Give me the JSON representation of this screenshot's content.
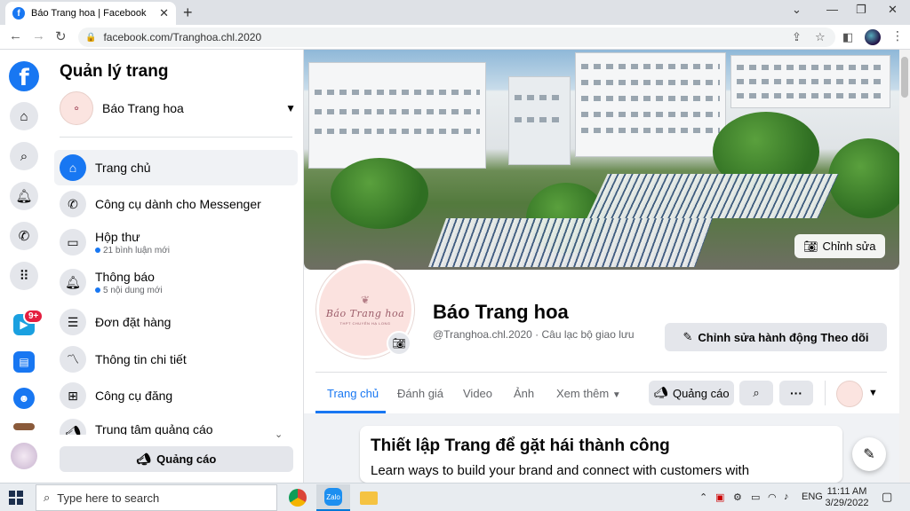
{
  "browser": {
    "tab_title": "Báo Trang hoa | Facebook",
    "url": "facebook.com/Tranghoa.chl.2020"
  },
  "panel": {
    "title": "Quản lý trang",
    "page_name": "Báo Trang hoa",
    "menu": [
      {
        "label": "Trang chủ",
        "sub": "",
        "icon": "home-icon"
      },
      {
        "label": "Công cụ dành cho Messenger",
        "sub": "",
        "icon": "messenger-icon"
      },
      {
        "label": "Hộp thư",
        "sub": "21 bình luận mới",
        "icon": "inbox-icon"
      },
      {
        "label": "Thông báo",
        "sub": "5 nội dung mới",
        "icon": "bell-icon"
      },
      {
        "label": "Đơn đặt hàng",
        "sub": "",
        "icon": "orders-icon"
      },
      {
        "label": "Thông tin chi tiết",
        "sub": "",
        "icon": "insights-icon"
      },
      {
        "label": "Công cụ đăng",
        "sub": "",
        "icon": "publishing-tools-icon"
      },
      {
        "label": "Trung tâm quảng cáo",
        "sub": "",
        "icon": "ad-center-icon"
      }
    ],
    "ad_button": "Quảng cáo"
  },
  "rail": {
    "notification_count": "9+"
  },
  "cover": {
    "edit_label": "Chỉnh sửa"
  },
  "profile": {
    "logo_text": "BÁO TRANG HOA",
    "name": "Báo Trang hoa",
    "meta": "@Tranghoa.chl.2020 · Câu lạc bộ giao lưu",
    "edit_action": "Chỉnh sửa hành động Theo dõi"
  },
  "tabs": {
    "items": [
      "Trang chủ",
      "Đánh giá",
      "Video",
      "Ảnh",
      "Xem thêm"
    ],
    "ads": "Quảng cáo"
  },
  "setup_card": {
    "title": "Thiết lập Trang để gặt hái thành công",
    "desc": "Learn ways to build your brand and connect with customers with"
  },
  "taskbar": {
    "search_placeholder": "Type here to search",
    "lang": "ENG",
    "time": "11:11 AM",
    "date": "3/29/2022"
  },
  "colors": {
    "accent": "#1877f2",
    "badge": "#e41e3f"
  }
}
